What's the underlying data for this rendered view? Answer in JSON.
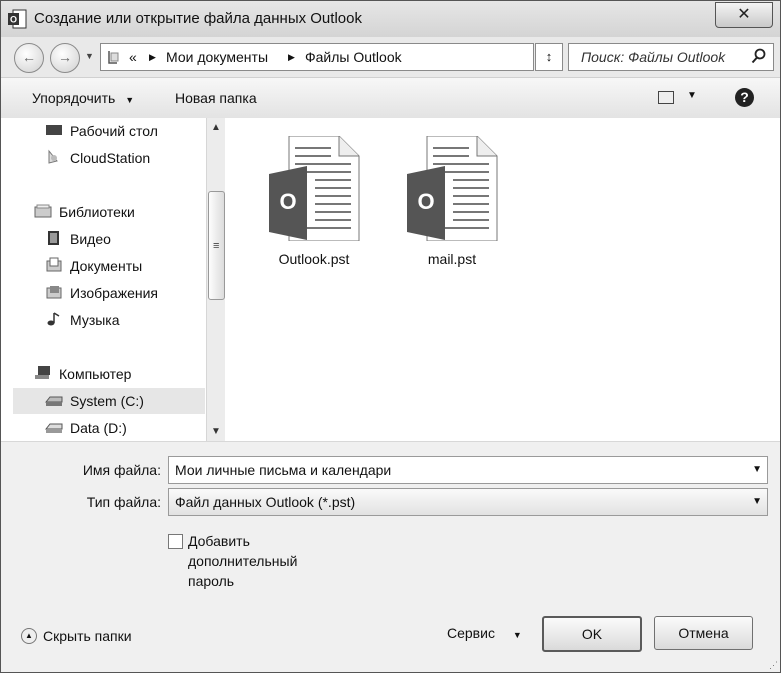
{
  "window": {
    "title": "Создание или открытие файла данных Outlook",
    "close_glyph": "✕"
  },
  "navbar": {
    "back_glyph": "←",
    "forward_glyph": "→",
    "overflow": "«",
    "crumb_sep": "▶",
    "breadcrumbs": [
      "Мои документы",
      "Файлы Outlook"
    ],
    "refresh_glyph": "↕",
    "search_placeholder": "Поиск: Файлы Outlook"
  },
  "toolbar": {
    "organize_label": "Упорядочить",
    "organize_arrow": "▼",
    "new_folder_label": "Новая папка",
    "view_arrow": "▼",
    "help_glyph": "?"
  },
  "sidebar": {
    "items": [
      {
        "label": "Рабочий стол",
        "icon": "desktop-icon"
      },
      {
        "label": "CloudStation",
        "icon": "cloudstation-icon"
      },
      {
        "label": "Библиотеки",
        "icon": "libraries-icon"
      },
      {
        "label": "Видео",
        "icon": "video-icon"
      },
      {
        "label": "Документы",
        "icon": "documents-icon"
      },
      {
        "label": "Изображения",
        "icon": "images-icon"
      },
      {
        "label": "Музыка",
        "icon": "music-icon"
      },
      {
        "label": "Компьютер",
        "icon": "computer-icon"
      },
      {
        "label": "System (C:)",
        "icon": "drive-icon",
        "selected": true
      },
      {
        "label": "Data (D:)",
        "icon": "drive-icon"
      }
    ],
    "scroll_up": "▲",
    "scroll_down": "▼",
    "scroll_grip": "≡"
  },
  "files": {
    "items": [
      {
        "name": "Outlook.pst",
        "badge": "O"
      },
      {
        "name": "mail.pst",
        "badge": "O"
      }
    ]
  },
  "form": {
    "filename_label": "Имя файла:",
    "filename_value": "Мои личные письма и календари",
    "filetype_label": "Тип файла:",
    "filetype_value": "Файл данных Outlook (*.pst)",
    "dropdown_arrow": "▼",
    "checkbox_label": "Добавить дополнительный пароль",
    "hide_folders_label": "Скрыть папки",
    "hide_folders_glyph": "▲",
    "service_label": "Сервис",
    "service_arrow": "▼",
    "ok_label": "OK",
    "cancel_label": "Отмена"
  }
}
